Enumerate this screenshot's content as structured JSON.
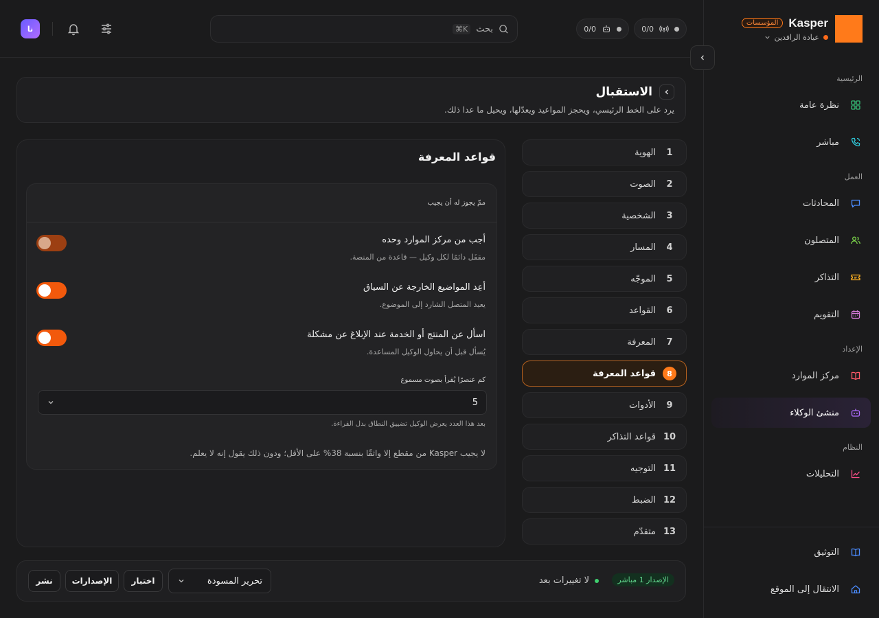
{
  "brand": {
    "name": "Kasper",
    "badge": "المؤسسات",
    "workspace": "عيادة الرافدين"
  },
  "topbar": {
    "search_placeholder": "بحث",
    "shortcut": "⌘K",
    "pill_calls": "0/0",
    "pill_bots": "0/0",
    "avatar_initials": "نا"
  },
  "sidebar": {
    "sections": [
      {
        "label": "الرئيسية",
        "items": [
          {
            "label": "نظرة عامة",
            "icon": "grid-icon",
            "color": "#37c27a"
          },
          {
            "label": "مباشر",
            "icon": "phone-icon",
            "color": "#2fc7d8"
          }
        ]
      },
      {
        "label": "العمل",
        "items": [
          {
            "label": "المحادثات",
            "icon": "chat-icon",
            "color": "#4b8cff"
          },
          {
            "label": "المتصلون",
            "icon": "users-icon",
            "color": "#7bd44a"
          },
          {
            "label": "التذاكر",
            "icon": "ticket-icon",
            "color": "#ffb020"
          },
          {
            "label": "التقويم",
            "icon": "calendar-icon",
            "color": "#d47ad8"
          }
        ]
      },
      {
        "label": "الإعداد",
        "items": [
          {
            "label": "مركز الموارد",
            "icon": "book-icon",
            "color": "#ff5a6a"
          },
          {
            "label": "منشئ الوكلاء",
            "icon": "bot-icon",
            "color": "#b06cff",
            "active": true
          }
        ]
      },
      {
        "label": "النظام",
        "items": [
          {
            "label": "التحليلات",
            "icon": "chart-icon",
            "color": "#ff4f8a"
          }
        ]
      }
    ],
    "bottom": [
      {
        "label": "التوثيق",
        "icon": "docs-icon",
        "color": "#4b8cff"
      },
      {
        "label": "الانتقال إلى الموقع",
        "icon": "home-icon",
        "color": "#4b8cff"
      }
    ]
  },
  "header": {
    "title": "الاستقبال",
    "subtitle": "يرد على الخط الرئيسي، ويحجز المواعيد ويعدّلها، ويحيل ما عدا ذلك."
  },
  "steps": [
    {
      "num": "1",
      "label": "الهوية"
    },
    {
      "num": "2",
      "label": "الصوت"
    },
    {
      "num": "3",
      "label": "الشخصية"
    },
    {
      "num": "4",
      "label": "المسار"
    },
    {
      "num": "5",
      "label": "الموجّه"
    },
    {
      "num": "6",
      "label": "القواعد"
    },
    {
      "num": "7",
      "label": "المعرفة"
    },
    {
      "num": "8",
      "label": "قواعد المعرفة",
      "active": true
    },
    {
      "num": "9",
      "label": "الأدوات"
    },
    {
      "num": "10",
      "label": "قواعد التذاكر"
    },
    {
      "num": "11",
      "label": "التوجيه"
    },
    {
      "num": "12",
      "label": "الضبط"
    },
    {
      "num": "13",
      "label": "متقدّم"
    }
  ],
  "panel": {
    "title": "قواعد المعرفة",
    "section_label": "ممّ يجوز له أن يجيب",
    "options": [
      {
        "title": "أجب من مركز الموارد وحده",
        "desc": "مقفَل دائمًا لكل وكيل — قاعدة من المنصة.",
        "on": true,
        "locked": true
      },
      {
        "title": "أعِد المواضيع الخارجة عن السياق",
        "desc": "يعيد المتصل الشارد إلى الموضوع.",
        "on": true,
        "locked": false
      },
      {
        "title": "اسأل عن المنتج أو الخدمة عند الإبلاغ عن مشكلة",
        "desc": "يُسأل قبل أن يحاول الوكيل المساعدة.",
        "on": true,
        "locked": false
      }
    ],
    "select_label": "كم عنصرًا يُقرأ بصوت مسموع",
    "select_value": "5",
    "select_help": "بعد هذا العدد يعرض الوكيل تضييق النطاق بدل القراءة.",
    "footnote": "لا يجيب Kasper من مقطع إلا واثقًا بنسبة 38% على الأقل؛ ودون ذلك يقول إنه لا يعلم."
  },
  "footer": {
    "version_badge": "الإصدار 1 مباشر",
    "status": "لا تغييرات بعد",
    "mode": "تحرير المسودة",
    "test": "اختبار",
    "versions": "الإصدارات",
    "publish": "نشر"
  }
}
